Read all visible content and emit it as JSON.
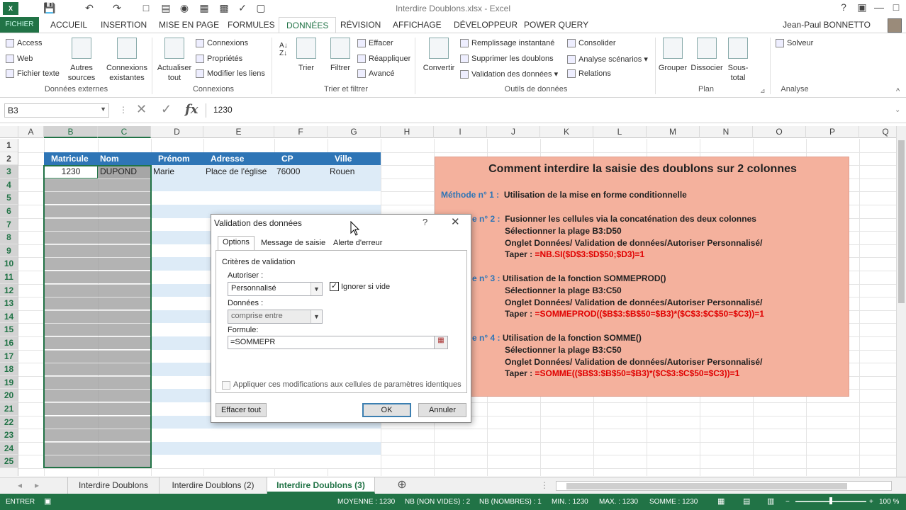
{
  "window": {
    "title": "Interdire Doublons.xlsx - Excel",
    "qat_icons": [
      "save-icon",
      "undo-icon",
      "redo-icon",
      "new-icon",
      "camera-icon",
      "calc-icon",
      "open-icon",
      "print-icon",
      "spell-icon"
    ]
  },
  "tabs": {
    "fichier": "FICHIER",
    "items": [
      "ACCUEIL",
      "INSERTION",
      "MISE EN PAGE",
      "FORMULES",
      "DONNÉES",
      "RÉVISION",
      "AFFICHAGE",
      "DÉVELOPPEUR",
      "POWER QUERY"
    ],
    "active": "DONNÉES",
    "user": "Jean-Paul BONNETTO"
  },
  "ribbon": {
    "ext_access": "Access",
    "ext_web": "Web",
    "ext_text": "Fichier texte",
    "ext_other": "Autres sources",
    "ext_existing": "Connexions existantes",
    "group_ext": "Données externes",
    "refresh": "Actualiser tout",
    "conn_connexions": "Connexions",
    "conn_props": "Propriétés",
    "conn_edit": "Modifier les liens",
    "group_conn": "Connexions",
    "sort": "Trier",
    "filter": "Filtrer",
    "clear": "Effacer",
    "reapply": "Réappliquer",
    "advanced": "Avancé",
    "group_sort": "Trier et filtrer",
    "convert": "Convertir",
    "flash": "Remplissage instantané",
    "remove_dup": "Supprimer les doublons",
    "validation": "Validation des données",
    "consolidate": "Consolider",
    "whatif": "Analyse scénarios",
    "relations": "Relations",
    "group_tools": "Outils de données",
    "group_btn": "Grouper",
    "ungroup_btn": "Dissocier",
    "subtotal_btn": "Sous-total",
    "group_plan": "Plan",
    "solver": "Solveur",
    "group_analysis": "Analyse"
  },
  "formula_bar": {
    "cell_ref": "B3",
    "value": "1230"
  },
  "columns": [
    "A",
    "B",
    "C",
    "D",
    "E",
    "F",
    "G",
    "H",
    "I",
    "J",
    "K",
    "L",
    "M",
    "N",
    "O",
    "P",
    "Q"
  ],
  "rows": [
    "1",
    "2",
    "3",
    "4",
    "5",
    "6",
    "7",
    "8",
    "9",
    "10",
    "11",
    "12",
    "13",
    "14",
    "15",
    "16",
    "17",
    "18",
    "19",
    "20",
    "21",
    "22",
    "23",
    "24",
    "25"
  ],
  "table": {
    "headers": [
      "Matricule",
      "Nom",
      "Prénom",
      "Adresse",
      "CP",
      "Ville"
    ],
    "row3": [
      "1230",
      "DUPOND",
      "Marie",
      "Place de l'église",
      "76000",
      "Rouen"
    ]
  },
  "info_box": {
    "title": "Comment interdire la saisie des doublons sur 2 colonnes",
    "m1_label": "Méthode n° 1 :",
    "m1_text": "Utilisation de la mise en forme conditionnelle",
    "m2_label": "e n° 2 :",
    "m2_text": "Fusionner les cellules via la concaténation des deux colonnes",
    "m2_sel": "Sélectionner la plage B3:D50",
    "m2_onglet": "Onglet Données/ Validation de données/Autoriser Personnalisé/",
    "m2_taper": "Taper :",
    "m2_formula": "=NB.SI($D$3:$D$50;$D3)=1",
    "m3_label": "e n° 3 :",
    "m3_text": "Utilisation de la fonction SOMMEPROD()",
    "m3_sel": "Sélectionner la plage B3:C50",
    "m3_onglet": "Onglet Données/ Validation de données/Autoriser Personnalisé/",
    "m3_taper": "Taper :",
    "m3_formula": "=SOMMEPROD(($B$3:$B$50=$B3)*($C$3:$C$50=$C3))=1",
    "m4_label": "e n° 4 :",
    "m4_text": "Utilisation de la fonction SOMME()",
    "m4_sel": "Sélectionner la plage B3:C50",
    "m4_onglet": "Onglet Données/ Validation de données/Autoriser Personnalisé/",
    "m4_taper": "Taper :",
    "m4_formula": "=SOMME(($B$3:$B$50=$B3)*($C$3:$C$50=$C3))=1"
  },
  "dialog": {
    "title": "Validation des données",
    "help": "?",
    "tabs": [
      "Options",
      "Message de saisie",
      "Alerte d'erreur"
    ],
    "criteria": "Critères de validation",
    "allow_label": "Autoriser :",
    "allow_value": "Personnalisé",
    "ignore_blank": "Ignorer si vide",
    "data_label": "Données :",
    "data_value": "comprise entre",
    "formula_label": "Formule:",
    "formula_value": "=SOMMEPR",
    "apply_all": "Appliquer ces modifications aux cellules de paramètres identiques",
    "clear_all": "Effacer tout",
    "ok": "OK",
    "cancel": "Annuler"
  },
  "sheets": {
    "items": [
      "Interdire Doublons",
      "Interdire Doublons (2)",
      "Interdire Doublons (3)"
    ],
    "active": "Interdire Doublons (3)"
  },
  "status": {
    "mode": "ENTRER",
    "moyenne": "MOYENNE : 1230",
    "nb_nonvides": "NB (NON VIDES) : 2",
    "nb_nombres": "NB (NOMBRES) : 1",
    "min": "MIN. : 1230",
    "max": "MAX. : 1230",
    "somme": "SOMME : 1230",
    "zoom": "100 %"
  },
  "colors": {
    "excel_green": "#217346",
    "table_header": "#2e75b6",
    "info_box": "#f4b19d",
    "formula_red": "#e00000"
  }
}
